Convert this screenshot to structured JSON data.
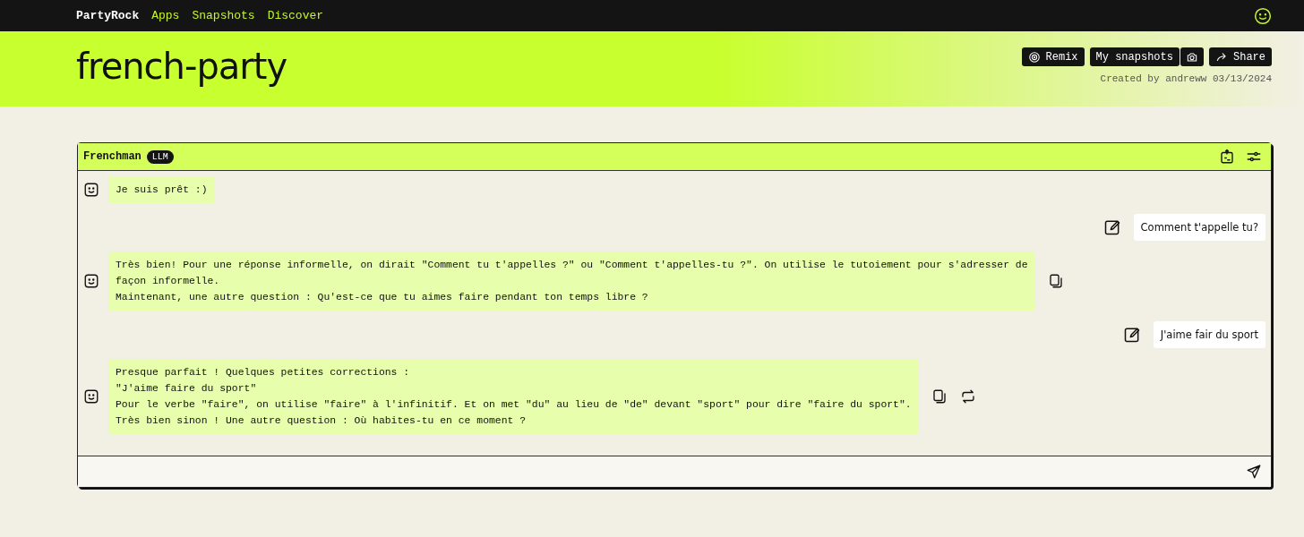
{
  "nav": {
    "brand": "PartyRock",
    "links": [
      {
        "label": "Apps"
      },
      {
        "label": "Snapshots"
      },
      {
        "label": "Discover"
      }
    ]
  },
  "header": {
    "title": "french-party",
    "buttons": [
      {
        "kind": "remix",
        "label": "Remix"
      },
      {
        "kind": "snapshots",
        "label": "My snapshots"
      },
      {
        "kind": "camera"
      },
      {
        "kind": "share",
        "label": "Share"
      }
    ],
    "created": "Created by andreww 03/13/2024"
  },
  "widget": {
    "title": "Frenchman",
    "badge": "LLM",
    "messages": [
      {
        "kind": "bot",
        "text": "Je suis prêt :)",
        "copy_button": false,
        "regenerate_button": false
      },
      {
        "kind": "user",
        "text": "Comment t'appelle tu?",
        "edit_button": true
      },
      {
        "kind": "bot",
        "text": "Très bien! Pour une réponse informelle, on dirait \"Comment tu t'appelles ?\" ou \"Comment t'appelles-tu ?\". On utilise le tutoiement pour s'adresser de\nfaçon informelle.\nMaintenant, une autre question : Qu'est-ce que tu aimes faire pendant ton temps libre ?",
        "copy_button": true,
        "regenerate_button": false
      },
      {
        "kind": "user",
        "text": "J'aime fair du sport",
        "edit_button": true
      },
      {
        "kind": "bot",
        "text": "Presque parfait ! Quelques petites corrections :\n\"J'aime faire du sport\"\nPour le verbe \"faire\", on utilise \"faire\" à l'infinitif. Et on met \"du\" au lieu de \"de\" devant \"sport\" pour dire \"faire du sport\".\nTrès bien sinon ! Une autre question : Où habites-tu en ce moment ?",
        "copy_button": true,
        "regenerate_button": true
      }
    ]
  }
}
